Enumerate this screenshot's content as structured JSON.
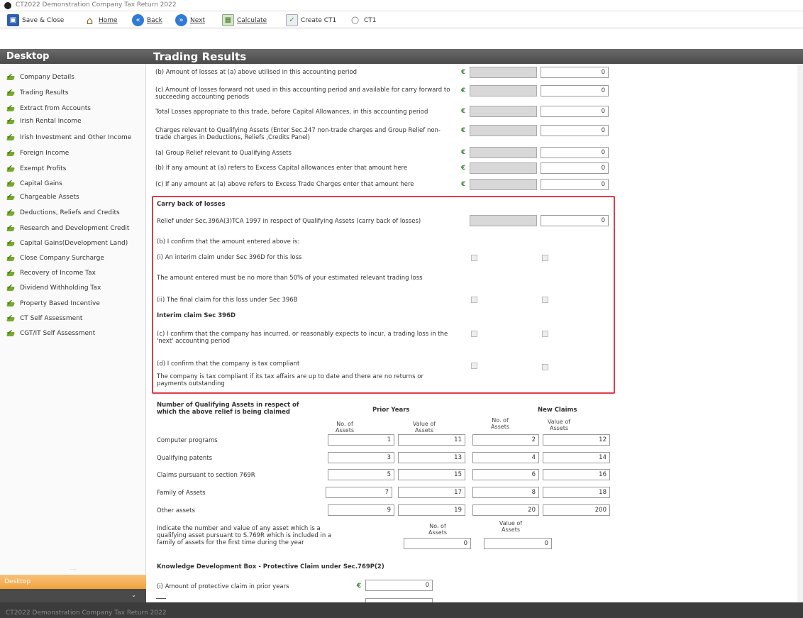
{
  "window": {
    "title": "CT2022 Demonstration Company Tax Return 2022"
  },
  "toolbar": {
    "save_close": "Save & Close",
    "home": "Home",
    "back": "Back",
    "next": "Next",
    "calculate": "Calculate",
    "create_ct1": "Create CT1",
    "ct1": "CT1"
  },
  "sidebar": {
    "title": "Desktop",
    "items": [
      "Company Details",
      "Trading Results",
      "Extract from Accounts",
      "Irish Rental Income",
      "Irish Investment and Other Income",
      "Foreign Income",
      "Exempt Profits",
      "Capital Gains",
      "Chargeable Assets",
      "Deductions, Reliefs and Credits",
      "Research and Development Credit",
      "Capital Gains(Development Land)",
      "Close Company Surcharge",
      "Recovery of Income Tax",
      "Dividend Withholding Tax",
      "Property Based Incentive",
      "CT Self Assessment",
      "CGT/IT Self Assessment"
    ],
    "bottom_tab": "Desktop"
  },
  "status": {
    "text": "CT2022 Demonstration Company Tax Return 2022"
  },
  "page": {
    "title": "Trading Results"
  },
  "rows": [
    {
      "label": "(b) Amount of losses at (a) above utilised in this accounting period",
      "value": "0"
    },
    {
      "label": "(c) Amount of losses forward not used in this accounting period and available for carry forward to succeeding accounting periods",
      "value": "0"
    },
    {
      "label": "Total Losses appropriate to this trade, before Capital Allowances, in this accounting period",
      "value": "0"
    },
    {
      "label": "Charges relevant to Qualifying Assets (Enter Sec.247 non-trade charges and Group Relief non-trade charges in Deductions, Reliefs ,Credits Panel)",
      "value": "0"
    },
    {
      "label": "(a) Group Relief relevant to Qualifying Assets",
      "value": "0"
    },
    {
      "label": "(b) If any amount at (a) refers to Excess Capital allowances enter that amount here",
      "value": "0"
    },
    {
      "label": "(c) If any amount at (a) above refers to Excess Trade Charges enter that amount here",
      "value": "0"
    }
  ],
  "carry_back": {
    "heading": "Carry back of losses",
    "relief_label": "Relief under Sec.396A(3)TCA 1997 in respect of Qualifying Assets (carry back of losses)",
    "relief_value": "0",
    "confirm_label": "(b) I confirm that the amount entered above is:",
    "interim_label": "(i) An interim claim under Sec 396D for this loss",
    "note_50": "The amount entered must be no more than 50% of your estimated relevant trading loss",
    "final_label": "(ii) The final claim for this loss under Sec 396B",
    "interim_heading": "Interim claim Sec 396D",
    "c_label": "(c) I confirm that the company has incurred, or reasonably expects to incur, a trading loss in the 'next' accounting period",
    "d_label": "(d) I confirm that the company is tax compliant",
    "d_note": "The company is tax compliant if its tax affairs are up to date and there are no returns or payments outstanding"
  },
  "assets": {
    "heading": "Number of Qualifying Assets in respect of which the above relief is being claimed",
    "prior_years": "Prior Years",
    "new_claims": "New Claims",
    "col_no": "No. of Assets",
    "col_value": "Value of Assets",
    "rows": [
      {
        "label": "Computer programs",
        "p_no": "1",
        "p_val": "11",
        "n_no": "2",
        "n_val": "12"
      },
      {
        "label": "Qualifying patents",
        "p_no": "3",
        "p_val": "13",
        "n_no": "4",
        "n_val": "14"
      },
      {
        "label": "Claims pursuant to section 769R",
        "p_no": "5",
        "p_val": "15",
        "n_no": "6",
        "n_val": "16"
      },
      {
        "label": "Family of Assets",
        "p_no": "7",
        "p_val": "17",
        "n_no": "8",
        "n_val": "18"
      },
      {
        "label": "Other assets",
        "p_no": "9",
        "p_val": "19",
        "n_no": "20",
        "n_val": "200"
      }
    ],
    "indicate_label": "Indicate the number and value of any asset which is a qualifying asset pursuant to S.769R which is included in a family of assets for the first time during the year",
    "indicate_no": "0",
    "indicate_val": "0"
  },
  "kdb": {
    "heading": "Knowledge Development Box - Protective Claim under Sec.769P(2)",
    "prior_label": "(i) Amount of protective claim in prior years",
    "prior_value": "0"
  },
  "currency_symbol": "€"
}
